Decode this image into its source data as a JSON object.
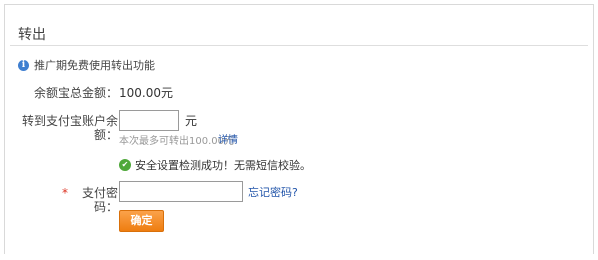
{
  "panel": {
    "title": "转出"
  },
  "notice": {
    "icon": "info-icon",
    "text": "推广期免费使用转出功能"
  },
  "balance": {
    "label": "余额宝总金额：",
    "value": "100.00元"
  },
  "transfer": {
    "label": "转到支付宝账户余额：",
    "amount_value": "",
    "unit": "元",
    "max_hint": "本次最多可转出100.00元",
    "detail_link": "详情"
  },
  "security": {
    "icon": "check-circle-icon",
    "message": "安全设置检测成功！无需短信校验。"
  },
  "password": {
    "required_mark": "*",
    "label": "支付密码：",
    "value": "",
    "forgot_link": "忘记密码?"
  },
  "actions": {
    "confirm_label": "确定"
  },
  "colors": {
    "button": "#f58a1f",
    "link": "#2255aa",
    "success": "#4fa83a",
    "info": "#3f7fd0",
    "required": "#dd3322"
  }
}
